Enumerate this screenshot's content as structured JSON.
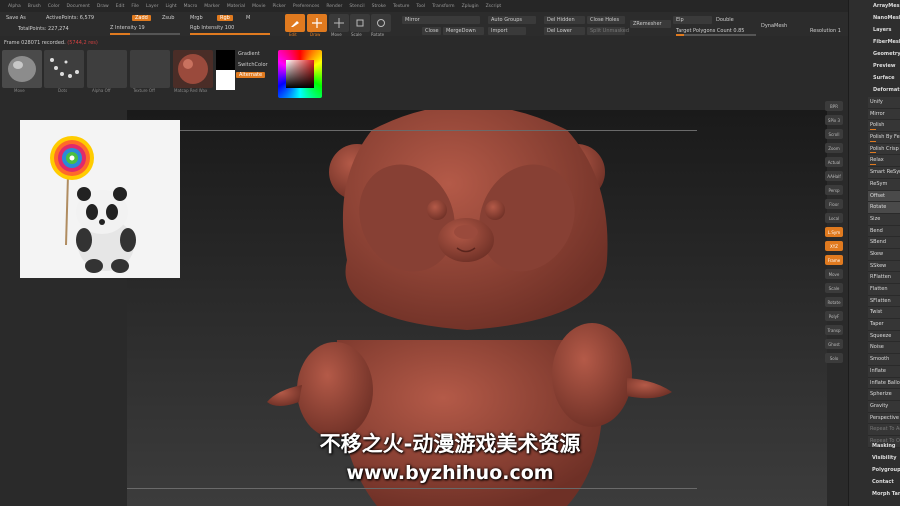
{
  "menu": [
    "Alpha",
    "Brush",
    "Color",
    "Document",
    "Draw",
    "Edit",
    "File",
    "Layer",
    "Light",
    "Macro",
    "Marker",
    "Material",
    "Movie",
    "Picker",
    "Preferences",
    "Render",
    "Stencil",
    "Stroke",
    "Texture",
    "Tool",
    "Transform",
    "Zplugin",
    "Zscript"
  ],
  "toolbar": {
    "save_as": "Save As",
    "active_points": "ActivePoints: 6,579",
    "total_points": "TotalPoints: 227,274",
    "zadd": "Zadd",
    "zsub": "Zsub",
    "z_intensity": "Z Intensity 19",
    "mrgb": "Mrgb",
    "rgb": "Rgb",
    "m": "M",
    "rgb_intensity": "Rgb Intensity 100",
    "edit": "Edit",
    "draw": "Draw",
    "move": "Move",
    "scale": "Scale",
    "rotate": "Rotate",
    "mirror": "Mirror",
    "auto_groups": "Auto Groups",
    "del_hidden": "Del Hidden",
    "close_holes": "Close Holes",
    "close": "Close",
    "merge_down": "MergeDown",
    "import": "Import",
    "del_lower": "Del Lower",
    "split_unmasked": "Split Unmasked",
    "zremesher": "ZRemesher",
    "elp": "Elp",
    "double": "Double",
    "dynamesh": "DynaMesh",
    "target_polygons": "Target Polygons Count 0.85",
    "resolution": "Resolution 1"
  },
  "status": {
    "frame": "Frame 028071 recorded.",
    "frame_extra": "(5744,2 res)"
  },
  "swatches": [
    {
      "name": "Move",
      "label": "Move"
    },
    {
      "name": "Dots",
      "label": "Dots"
    },
    {
      "name": "Alpha Off",
      "label": "Alpha Off"
    },
    {
      "name": "Texture Off",
      "label": "Texture Off"
    },
    {
      "name": "Matcap",
      "label": "Matcap Red Wax"
    }
  ],
  "color": {
    "gradient": "Gradient",
    "switch_color": "SwitchColor",
    "alternate": "Alternate"
  },
  "right_tools": [
    "BPR",
    "SPix 3",
    "Scroll",
    "Zoom",
    "Actual",
    "AAHalf",
    "Persp",
    "Floor",
    "Local",
    "L.Sym",
    "XYZ",
    "Frame",
    "Move",
    "Scale",
    "Rotate",
    "PolyF",
    "Transp",
    "Ghost",
    "Solo"
  ],
  "right_panel_top": [
    "ArrayMesh",
    "NanoMesh",
    "Layers",
    "FiberMesh",
    "Geometry HD",
    "Preview",
    "Surface",
    "Deformation"
  ],
  "right_panel_deform": [
    {
      "label": "Unify"
    },
    {
      "label": "Mirror"
    },
    {
      "label": "Polish",
      "bar": true
    },
    {
      "label": "Polish By Features",
      "bar": true
    },
    {
      "label": "Polish Crisp Edges",
      "bar": true
    },
    {
      "label": "Relax",
      "bar": true
    },
    {
      "label": "Smart ReSym"
    },
    {
      "label": "ReSym"
    },
    {
      "label": "Offset",
      "hl": true
    },
    {
      "label": "Rotate",
      "hl": true
    },
    {
      "label": "Size"
    },
    {
      "label": "Bend"
    },
    {
      "label": "SBend"
    },
    {
      "label": "Skew"
    },
    {
      "label": "SSkew"
    },
    {
      "label": "RFlatten"
    },
    {
      "label": "Flatten"
    },
    {
      "label": "SFlatten"
    },
    {
      "label": "Twist"
    },
    {
      "label": "Taper"
    },
    {
      "label": "Squeeze"
    },
    {
      "label": "Noise"
    },
    {
      "label": "Smooth"
    },
    {
      "label": "Inflate"
    },
    {
      "label": "Inflate Balloon"
    },
    {
      "label": "Spherize"
    },
    {
      "label": "Gravity"
    },
    {
      "label": "Perspective"
    },
    {
      "label": "Repeat To Active"
    },
    {
      "label": "Repeat To Other"
    }
  ],
  "right_panel_bottom": [
    "Masking",
    "Visibility",
    "Polygroups",
    "Contact",
    "Morph Target"
  ],
  "watermark": {
    "line1": "不移之火-动漫游戏美术资源",
    "line2": "www.byzhihuo.com"
  },
  "colors": {
    "accent": "#e07a1f",
    "model": "#9a4a3c",
    "canvas_top": "#1a1a1a",
    "canvas_bottom": "#3c3c3c"
  }
}
